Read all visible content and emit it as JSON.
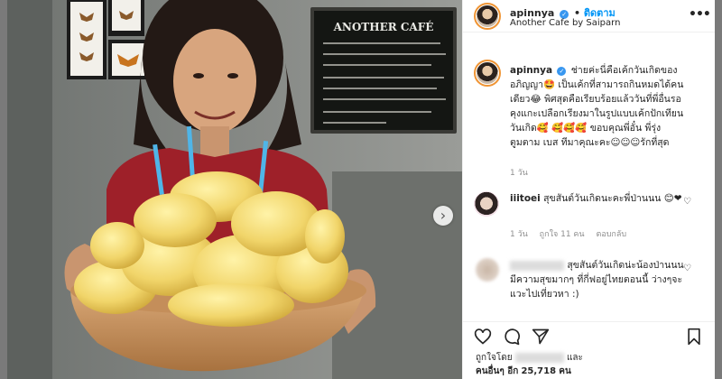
{
  "media": {
    "sign_title": "ANOTHER CAFÉ",
    "next_label": "›"
  },
  "header": {
    "username": "apinnya",
    "verified_mark": "✓",
    "separator": "•",
    "follow_label": "ติดตาม",
    "location": "Another Cafe by Saiparn",
    "more_label": "•••"
  },
  "caption": {
    "username": "apinnya",
    "text": "ช่ายค่ะนี่คือเค้กวันเกิดของอภิญญา🤩 เป็นเค้กที่สามารถกินหมดได้คนเดียว😂 พิศสุดคือเรียบร้อยแล้ววันที่พี่อื่นรอคุงแกะเปลือกเรียงมาในรูปแบบเค้กปักเทียนวันเกิด🥰 🥰🥰🥰 ขอบคุณพี่อั๋น พี่รุ่ง ตูมตาม เบส ทีมาคุณะคะ☺☺☺รักที่สุด",
    "time": "1 วัน"
  },
  "comments": [
    {
      "username": "iiitoei",
      "text": "สุขสันต์วันเกิดนะคะพี่ป่านนน 😊❤",
      "time": "1 วัน",
      "likes": "ถูกใจ 11 คน",
      "reply": "ตอบกลับ",
      "heart": "♡"
    },
    {
      "username": "",
      "text": "สุขสันต์วันเกิดน่ะน้องป่านนน มีความสุขมากๆ ที่กี่ฟอยู่ไทยตอนนี้ ว่างๆจะแวะไปเที่ยวหา :)",
      "heart": "♡"
    }
  ],
  "actions": {
    "like_icon": "heart-outline-icon",
    "comment_icon": "speech-bubble-icon",
    "share_icon": "paper-plane-icon",
    "save_icon": "bookmark-icon"
  },
  "likes": {
    "prefix": "ถูกใจโดย",
    "and": "และ",
    "others_prefix": "คนอื่นๆ อีก",
    "count": "25,718",
    "suffix": "คน"
  },
  "colors": {
    "follow": "#0095f6",
    "verified": "#3897f0",
    "muted": "#8e8e8e"
  }
}
